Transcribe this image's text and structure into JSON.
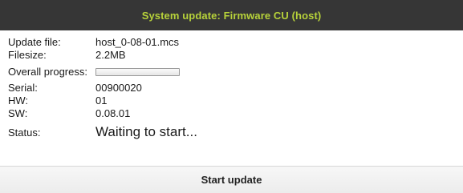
{
  "window": {
    "title": "System update: Firmware CU (host)"
  },
  "fields": {
    "update_file": {
      "label": "Update file:",
      "value": "host_0-08-01.mcs"
    },
    "filesize": {
      "label": "Filesize:",
      "value": "2.2MB"
    },
    "overall_progress": {
      "label": "Overall progress:",
      "fraction": 0.0
    },
    "serial": {
      "label": "Serial:",
      "value": "00900020"
    },
    "hw": {
      "label": "HW:",
      "value": "01"
    },
    "sw": {
      "label": "SW:",
      "value": "0.08.01"
    },
    "status": {
      "label": "Status:",
      "value": "Waiting to start..."
    }
  },
  "footer": {
    "start_label": "Start update"
  },
  "colors": {
    "title_bar": "#363636",
    "title_text": "#b7d23a",
    "progress_fill": "#6fa2d8"
  }
}
